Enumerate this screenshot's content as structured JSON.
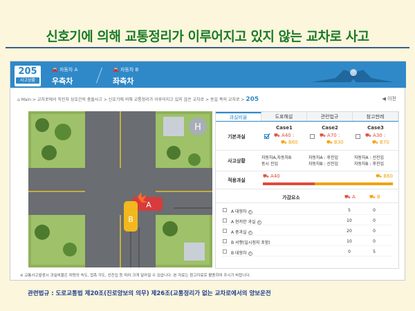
{
  "slide": {
    "title": "신호기에 의해 교통정리가 이루어지고 있지 않는 교차로 사고",
    "law_line": "관련법규 :  도로교통법 제20조(진로양보의 의무)   제26조(교통정리가 없는 교차로에서의 양보운전"
  },
  "header": {
    "case_number": "205",
    "case_badge_label": "사고상황",
    "vehicle_a": {
      "small": "자동차 A",
      "big": "우측차"
    },
    "vehicle_b": {
      "small": "자동차 B",
      "big": "좌측차"
    }
  },
  "breadcrumb": {
    "path": "Main  >  교차로에서 직진차 상호간의 충돌사고  >  신호기에 의해 교통정리가 이루어지고 있지 않은 교차로  >  동일 폭의 교차로  >",
    "case_number": "205",
    "prev_label": "이전"
  },
  "map": {
    "car_a_label": "A",
    "car_b_label": "B",
    "heli_label": "H"
  },
  "tabs": [
    "과실비율",
    "도표해설",
    "관련법규",
    "참고판례"
  ],
  "panel": {
    "basic_label": "기본과실",
    "situation_label": "사고상황",
    "applied_label": "적용과실",
    "cases": [
      {
        "name": "Case1",
        "a": "A40 :",
        "b": "B60",
        "checked": true,
        "sit1": "자동차A,자동차B",
        "sit2": "동시 진입"
      },
      {
        "name": "Case2",
        "a": "A70 :",
        "b": "B30",
        "checked": false,
        "sit1": "자동차A : 후진입",
        "sit2": "자동차B : 선진입"
      },
      {
        "name": "Case3",
        "a": "A30 :",
        "b": "B70",
        "checked": false,
        "sit1": "자동차A : 선진입",
        "sit2": "자동차B : 후진입"
      }
    ],
    "applied": {
      "a_label": "A40",
      "b_label": "B60",
      "a_fraction": 0.4
    },
    "factors_title": "가감요소",
    "factors_col_a": "A",
    "factors_col_b": "B",
    "factors": [
      {
        "name": "A 대형차",
        "info": true,
        "a": "5",
        "b": "0"
      },
      {
        "name": "A 현저한 과실",
        "info": true,
        "a": "10",
        "b": "0"
      },
      {
        "name": "A 중과실",
        "info": true,
        "a": "20",
        "b": "0"
      },
      {
        "name": "B 서행(일시정지 포함)",
        "info": false,
        "a": "10",
        "b": "0"
      },
      {
        "name": "B 대형차",
        "info": true,
        "a": "0",
        "b": "5"
      }
    ]
  },
  "note": "※ 교통사고발생시 과실비율은 차량의 속도, 접촉 각도, 선진입 등 따라 크게 달라질 수 있습니다. 본 자료는 참고자료로 활용하여 주시기 바랍니다.",
  "colors": {
    "accent": "#2f89c8",
    "a_color": "#e04b3a",
    "b_color": "#f2a20f",
    "title_green": "#1a7a28"
  }
}
